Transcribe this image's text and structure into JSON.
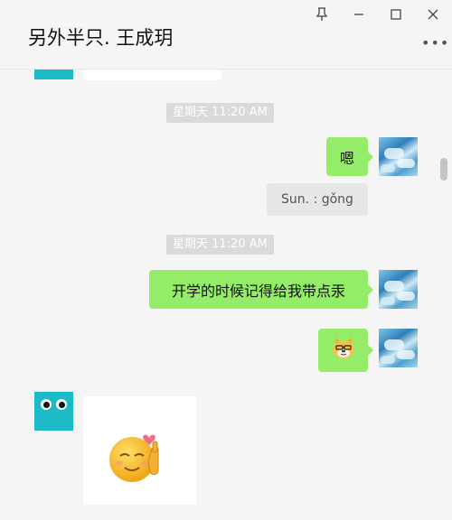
{
  "window": {
    "title": "另外半只. 王成玥",
    "controls": [
      "pin-icon",
      "minimize-icon",
      "maximize-icon",
      "close-icon"
    ],
    "more_icon": "more-dots-icon"
  },
  "messages": [
    {
      "type": "time",
      "text": "星期天 11:20 AM"
    },
    {
      "type": "text",
      "from": "me",
      "text": "嗯"
    },
    {
      "type": "quote",
      "text": "Sun. : gǒng"
    },
    {
      "type": "time",
      "text": "星期天 11:20 AM"
    },
    {
      "type": "text",
      "from": "me",
      "text": "开学的时候记得给我带点汞"
    },
    {
      "type": "emoji",
      "from": "me",
      "icon": "doge-emoji-icon"
    },
    {
      "type": "sticker",
      "from": "other",
      "icon": "smiling-face-heart-sticker-icon"
    }
  ],
  "colors": {
    "bubble_me": "#95ec69",
    "background": "#f5f5f5",
    "other_avatar": "#1cb9c6"
  }
}
